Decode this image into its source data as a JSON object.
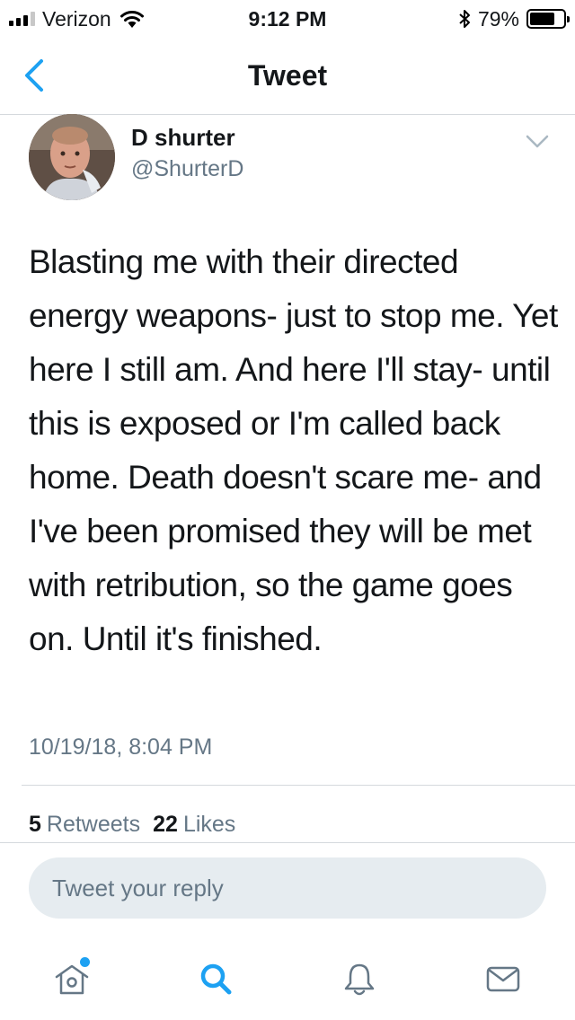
{
  "status_bar": {
    "carrier": "Verizon",
    "time": "9:12 PM",
    "battery": "79%",
    "battery_level": 0.79,
    "icons": [
      "signal-icon",
      "wifi-icon",
      "bluetooth-icon",
      "battery-icon"
    ]
  },
  "nav": {
    "title": "Tweet",
    "back_icon": "chevron-left-icon"
  },
  "tweet": {
    "author_name": "D shurter",
    "author_handle": "@ShurterD",
    "text": "Blasting me with their directed energy weapons- just to stop me. Yet here I still am. And here I'll stay- until this is exposed or I'm called back home. Death doesn't scare me- and I've been promised they will be met with retribution, so the game goes on. Until it's finished.",
    "timestamp": "10/19/18, 8:04 PM",
    "retweets_count": "5",
    "retweets_label": "Retweets",
    "likes_count": "22",
    "likes_label": "Likes"
  },
  "reply": {
    "placeholder": "Tweet your reply"
  },
  "tab_bar": {
    "tabs": [
      {
        "icon": "home-icon",
        "active": false,
        "notification_dot": true
      },
      {
        "icon": "search-icon",
        "active": true,
        "notification_dot": false
      },
      {
        "icon": "bell-icon",
        "active": false,
        "notification_dot": false
      },
      {
        "icon": "mail-icon",
        "active": false,
        "notification_dot": false
      }
    ]
  },
  "colors": {
    "accent": "#1da1f2",
    "secondary_text": "#657786",
    "divider": "#d5d9dd",
    "reply_bg": "#e6ecf0"
  }
}
